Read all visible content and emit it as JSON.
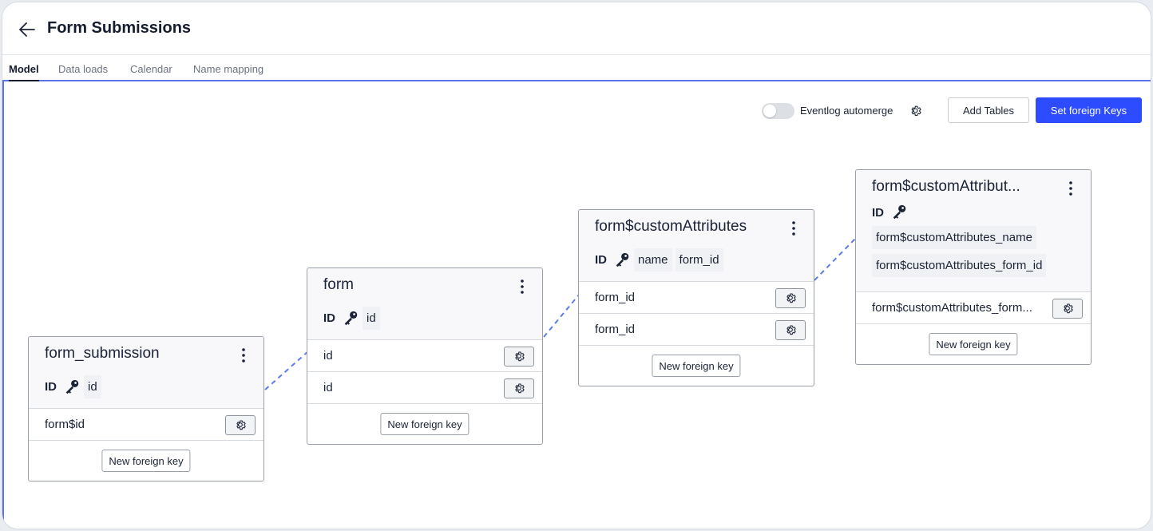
{
  "header": {
    "title": "Form Submissions"
  },
  "tabs": [
    {
      "label": "Model",
      "active": true
    },
    {
      "label": "Data loads",
      "active": false
    },
    {
      "label": "Calendar",
      "active": false
    },
    {
      "label": "Name mapping",
      "active": false
    }
  ],
  "toolbar": {
    "automerge_label": "Eventlog automerge",
    "automerge_on": false,
    "add_tables_label": "Add Tables",
    "set_keys_label": "Set foreign Keys"
  },
  "colors": {
    "accent": "#2d4cff",
    "connector": "#5b7de8",
    "tab_underline": "#5b73e8"
  },
  "tables": [
    {
      "name": "form_submission",
      "id_label": "ID",
      "id_columns": [
        "id"
      ],
      "foreign_keys": [
        "form$id"
      ],
      "new_fk_label": "New foreign key"
    },
    {
      "name": "form",
      "id_label": "ID",
      "id_columns": [
        "id"
      ],
      "foreign_keys": [
        "id",
        "id"
      ],
      "new_fk_label": "New foreign key"
    },
    {
      "name": "form$customAttributes",
      "id_label": "ID",
      "id_columns": [
        "name",
        "form_id"
      ],
      "foreign_keys": [
        "form_id",
        "form_id"
      ],
      "new_fk_label": "New foreign key"
    },
    {
      "name": "form$customAttribut...",
      "id_label": "ID",
      "id_columns": [
        "form$customAttributes_name",
        "form$customAttributes_form_id"
      ],
      "foreign_keys": [
        "form$customAttributes_form..."
      ],
      "new_fk_label": "New foreign key"
    }
  ]
}
